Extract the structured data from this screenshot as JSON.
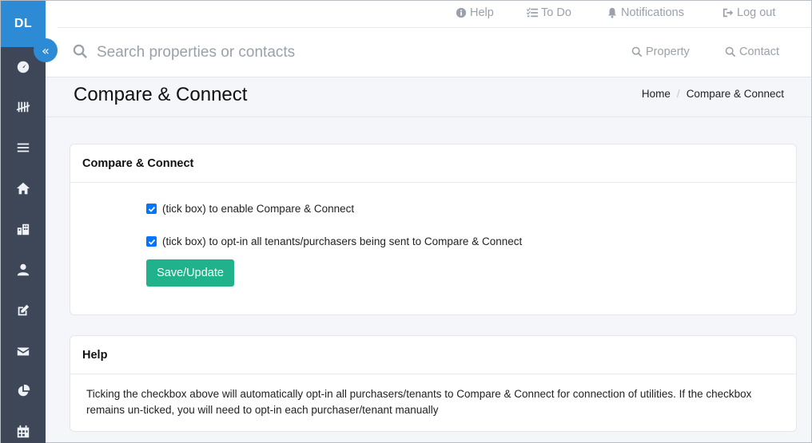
{
  "sidebar": {
    "logo": "DL",
    "collapse_glyph": "«",
    "items": [
      {
        "icon": "dashboard-icon"
      },
      {
        "icon": "tally-icon"
      },
      {
        "icon": "list-icon"
      },
      {
        "icon": "home-icon"
      },
      {
        "icon": "building-icon"
      },
      {
        "icon": "user-icon"
      },
      {
        "icon": "edit-icon"
      },
      {
        "icon": "envelope-icon"
      },
      {
        "icon": "pie-chart-icon"
      },
      {
        "icon": "calendar-icon"
      }
    ]
  },
  "topbar": {
    "help": "Help",
    "todo": "To Do",
    "notifications": "Notifications",
    "logout": "Log out"
  },
  "search": {
    "placeholder": "Search properties or contacts",
    "property_filter": "Property",
    "contact_filter": "Contact"
  },
  "page": {
    "title": "Compare & Connect",
    "breadcrumb": [
      "Home",
      "Compare & Connect"
    ]
  },
  "settings_card": {
    "title": "Compare & Connect",
    "checkbox_enable": {
      "label": "(tick box) to enable Compare & Connect",
      "checked": true
    },
    "checkbox_optin": {
      "label": "(tick box) to opt-in all tenants/purchasers being sent to Compare & Connect",
      "checked": true
    },
    "save_label": "Save/Update"
  },
  "help_card": {
    "title": "Help",
    "text": "Ticking the checkbox above will automatically opt-in all purchasers/tenants to Compare & Connect for connection of utilities. If the checkbox remains un-ticked, you will need to opt-in each purchaser/tenant manually"
  },
  "colors": {
    "sidebar": "#3d4758",
    "accent": "#2d8bd6",
    "save_button": "#20b28a",
    "checkbox": "#0075ff"
  }
}
